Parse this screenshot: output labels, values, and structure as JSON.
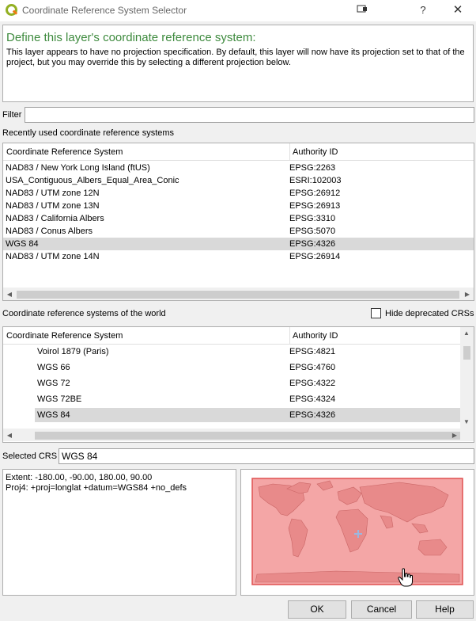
{
  "window": {
    "title": "Coordinate Reference System Selector",
    "help_glyph": "?",
    "close_glyph": "✕",
    "icon": "qgis-logo-icon"
  },
  "header": {
    "title": "Define this layer's coordinate reference system:",
    "description": "This layer appears to have no projection specification. By default, this layer will now have its projection set to that of the project, but you may override this by selecting a different projection below."
  },
  "filter": {
    "label": "Filter",
    "value": ""
  },
  "recent": {
    "label": "Recently used coordinate reference systems",
    "columns": [
      "Coordinate Reference System",
      "Authority ID"
    ],
    "rows": [
      {
        "name": "NAD83 / New York Long Island (ftUS)",
        "id": "EPSG:2263"
      },
      {
        "name": "USA_Contiguous_Albers_Equal_Area_Conic",
        "id": "ESRI:102003"
      },
      {
        "name": "NAD83 / UTM zone 12N",
        "id": "EPSG:26912"
      },
      {
        "name": "NAD83 / UTM zone 13N",
        "id": "EPSG:26913"
      },
      {
        "name": "NAD83 / California Albers",
        "id": "EPSG:3310"
      },
      {
        "name": "NAD83 / Conus Albers",
        "id": "EPSG:5070"
      },
      {
        "name": "WGS 84",
        "id": "EPSG:4326"
      },
      {
        "name": "NAD83 / UTM zone 14N",
        "id": "EPSG:26914"
      }
    ]
  },
  "world": {
    "label": "Coordinate reference systems of the world",
    "hide_deprecated_label": "Hide deprecated CRSs",
    "columns": [
      "Coordinate Reference System",
      "Authority ID"
    ],
    "rows": [
      {
        "name": "Voirol 1879 (Paris)",
        "id": "EPSG:4821"
      },
      {
        "name": "WGS 66",
        "id": "EPSG:4760"
      },
      {
        "name": "WGS 72",
        "id": "EPSG:4322"
      },
      {
        "name": "WGS 72BE",
        "id": "EPSG:4324"
      },
      {
        "name": "WGS 84",
        "id": "EPSG:4326"
      }
    ]
  },
  "selected_crs": {
    "label": "Selected CRS",
    "value": "WGS 84"
  },
  "info": {
    "extent": "Extent: -180.00, -90.00, 180.00, 90.00",
    "proj4": "Proj4: +proj=longlat +datum=WGS84 +no_defs"
  },
  "buttons": {
    "ok": "OK",
    "cancel": "Cancel",
    "help": "Help"
  },
  "colors": {
    "header_title": "#3d8a3d",
    "extent_fill": "#f4a6a6",
    "extent_border": "#e05050",
    "selected_row": "#d9d9d9"
  }
}
